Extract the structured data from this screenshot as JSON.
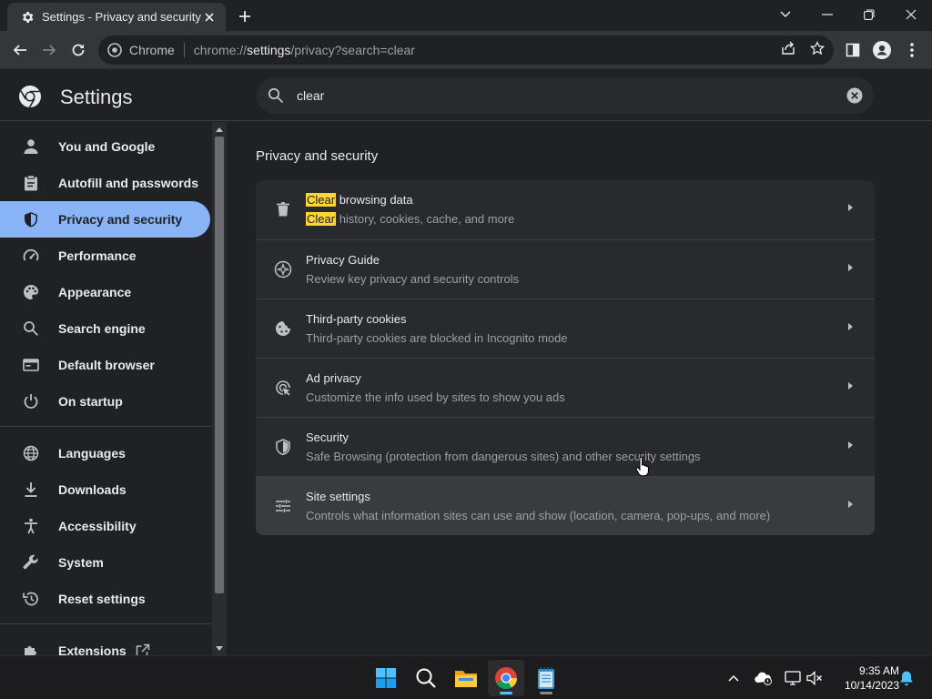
{
  "tab": {
    "title": "Settings - Privacy and security",
    "favicon": "gear-icon"
  },
  "omnibox": {
    "site_chip": "Chrome",
    "url_prefix": "chrome://",
    "url_host": "settings",
    "url_path": "/privacy?search=clear"
  },
  "settings": {
    "title": "Settings",
    "search_value": "clear"
  },
  "sidebar": {
    "items": [
      {
        "label": "You and Google",
        "icon": "person-icon"
      },
      {
        "label": "Autofill and passwords",
        "icon": "clipboard-icon"
      },
      {
        "label": "Privacy and security",
        "icon": "shield-icon",
        "active": true
      },
      {
        "label": "Performance",
        "icon": "gauge-icon"
      },
      {
        "label": "Appearance",
        "icon": "palette-icon"
      },
      {
        "label": "Search engine",
        "icon": "search-icon"
      },
      {
        "label": "Default browser",
        "icon": "browser-window-icon"
      },
      {
        "label": "On startup",
        "icon": "power-icon"
      },
      {
        "label": "Languages",
        "icon": "globe-icon"
      },
      {
        "label": "Downloads",
        "icon": "download-icon"
      },
      {
        "label": "Accessibility",
        "icon": "accessibility-icon"
      },
      {
        "label": "System",
        "icon": "wrench-icon"
      },
      {
        "label": "Reset settings",
        "icon": "history-icon"
      },
      {
        "label": "Extensions",
        "icon": "puzzle-icon"
      }
    ]
  },
  "main": {
    "section_title": "Privacy and security",
    "highlight": "Clear",
    "rows": [
      {
        "title_rest": " browsing data",
        "subtitle_rest": " history, cookies, cache, and more",
        "icon": "trash-icon"
      },
      {
        "title": "Privacy Guide",
        "subtitle": "Review key privacy and security controls",
        "icon": "compass-icon"
      },
      {
        "title": "Third-party cookies",
        "subtitle": "Third-party cookies are blocked in Incognito mode",
        "icon": "cookie-icon"
      },
      {
        "title": "Ad privacy",
        "subtitle": "Customize the info used by sites to show you ads",
        "icon": "ad-privacy-icon"
      },
      {
        "title": "Security",
        "subtitle": "Safe Browsing (protection from dangerous sites) and other security settings",
        "icon": "shield-icon"
      },
      {
        "title": "Site settings",
        "subtitle": "Controls what information sites can use and show (location, camera, pop-ups, and more)",
        "icon": "sliders-icon"
      }
    ]
  },
  "taskbar": {
    "apps": [
      "windows-start-icon",
      "search-icon",
      "file-explorer-icon",
      "chrome-icon",
      "notepad-icon"
    ],
    "time": "9:35 AM",
    "date": "10/14/2023"
  },
  "colors": {
    "accent": "#8ab4f8",
    "highlight": "#fdd633",
    "background": "#202124",
    "card": "#292a2d"
  }
}
